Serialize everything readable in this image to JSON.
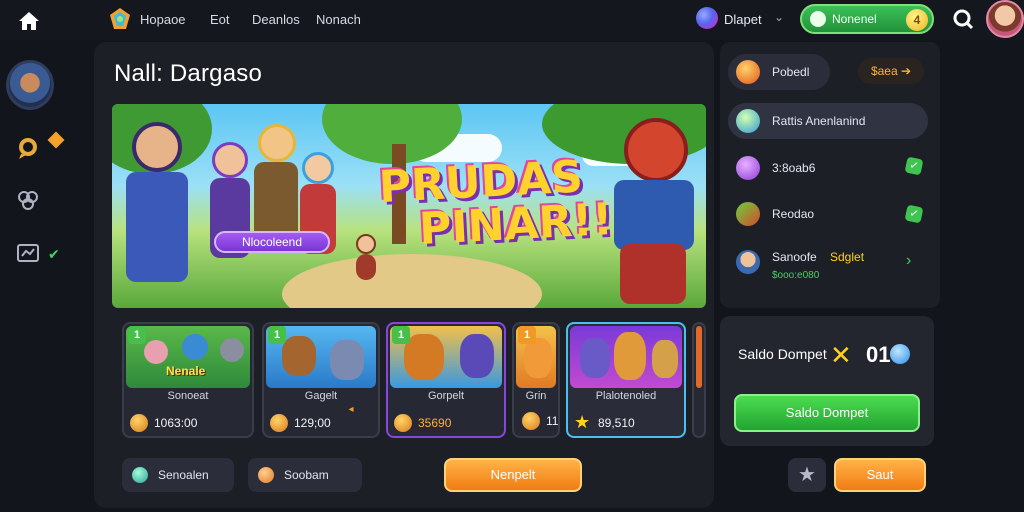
{
  "topbar": {
    "brand": "Hopaoe",
    "nav": [
      "Eot",
      "Deanlos",
      "Nonach"
    ],
    "wallet_label": "Dlapet",
    "search_label": "Nonenel",
    "search_badge": "4"
  },
  "page": {
    "title": "Nall: Dargaso"
  },
  "hero": {
    "title_line1": "PRUDAS",
    "title_line2": "PINAR!!",
    "pill_label": "Nlocoleend"
  },
  "cards": [
    {
      "badge": "1",
      "art_label": "Nenale",
      "name": "Sonoeat",
      "price": "1063:00"
    },
    {
      "badge": "1",
      "name": "Gagelt",
      "price": "129;00"
    },
    {
      "badge": "1",
      "name": "Gorpelt",
      "price": "35690"
    },
    {
      "badge": "1",
      "name": "Grin",
      "price": "11"
    },
    {
      "name": "Plalotenoled",
      "price": "89,510"
    }
  ],
  "bottom": {
    "btn1": "Senoalen",
    "btn2": "Soobam",
    "btn3": "Nenpelt",
    "btn4": "Saut"
  },
  "right": {
    "row1": "Pobedl",
    "price_chip": "$aea ➔",
    "row2": "Rattis Anenlanind",
    "row3": "3:8oab6",
    "row4": "Reodao",
    "row5_a": "Sanoofe",
    "row5_b": "Sdglet",
    "row5_sub": "$ooo:e080"
  },
  "balance": {
    "label": "Saldo Dompet",
    "value": "01",
    "button": "Saldo Dompet"
  },
  "colors": {
    "accent_green": "#3cc058",
    "accent_orange": "#f59a2a",
    "accent_purple": "#8a44e0",
    "gold": "#ffd21e"
  }
}
